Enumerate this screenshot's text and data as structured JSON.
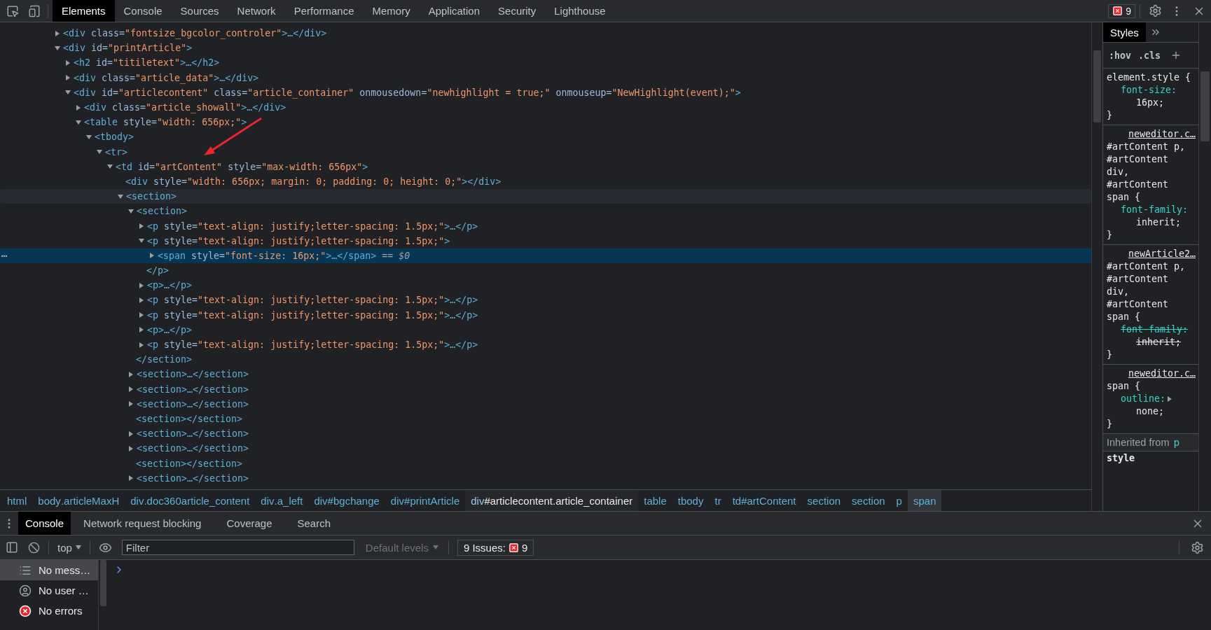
{
  "toolbar": {
    "tabs": [
      {
        "label": "Elements",
        "selected": true
      },
      {
        "label": "Console",
        "selected": false
      },
      {
        "label": "Sources",
        "selected": false
      },
      {
        "label": "Network",
        "selected": false
      },
      {
        "label": "Performance",
        "selected": false
      },
      {
        "label": "Memory",
        "selected": false
      },
      {
        "label": "Application",
        "selected": false
      },
      {
        "label": "Security",
        "selected": false
      },
      {
        "label": "Lighthouse",
        "selected": false
      }
    ],
    "issues_count": "9"
  },
  "dom_tree": [
    {
      "expanded": false,
      "selected": false,
      "hovered": false,
      "tokens": [
        {
          "kind": "tag",
          "text": "<div"
        },
        {
          "kind": "attr",
          "text": " class="
        },
        {
          "kind": "value",
          "text": "\"fontsize_bgcolor_controler\""
        },
        {
          "kind": "tag",
          "text": ">…</div>"
        }
      ]
    },
    {
      "expanded": true,
      "selected": false,
      "hovered": false,
      "tokens": [
        {
          "kind": "tag",
          "text": "<div"
        },
        {
          "kind": "attr",
          "text": " id="
        },
        {
          "kind": "value",
          "text": "\"printArticle\""
        },
        {
          "kind": "tag",
          "text": ">"
        }
      ],
      "children": [
        {
          "expanded": false,
          "selected": false,
          "hovered": false,
          "tokens": [
            {
              "kind": "tag",
              "text": "<h2"
            },
            {
              "kind": "attr",
              "text": " id="
            },
            {
              "kind": "value",
              "text": "\"titiletext\""
            },
            {
              "kind": "tag",
              "text": ">…</h2>"
            }
          ]
        },
        {
          "expanded": false,
          "selected": false,
          "hovered": false,
          "tokens": [
            {
              "kind": "tag",
              "text": "<div"
            },
            {
              "kind": "attr",
              "text": " class="
            },
            {
              "kind": "value",
              "text": "\"article_data\""
            },
            {
              "kind": "tag",
              "text": ">…</div>"
            }
          ]
        },
        {
          "expanded": true,
          "selected": false,
          "hovered": false,
          "tokens": [
            {
              "kind": "tag",
              "text": "<div"
            },
            {
              "kind": "attr",
              "text": " id="
            },
            {
              "kind": "value",
              "text": "\"articlecontent\""
            },
            {
              "kind": "attr",
              "text": " class="
            },
            {
              "kind": "value",
              "text": "\"article_container\""
            },
            {
              "kind": "attr",
              "text": " onmousedown="
            },
            {
              "kind": "value",
              "text": "\"newhighlight = true;\""
            },
            {
              "kind": "attr",
              "text": " onmouseup="
            },
            {
              "kind": "value",
              "text": "\"NewHighlight(event);\""
            },
            {
              "kind": "tag",
              "text": ">"
            }
          ],
          "children": [
            {
              "expanded": false,
              "selected": false,
              "hovered": false,
              "tokens": [
                {
                  "kind": "tag",
                  "text": "<div"
                },
                {
                  "kind": "attr",
                  "text": " class="
                },
                {
                  "kind": "value",
                  "text": "\"article_showall\""
                },
                {
                  "kind": "tag",
                  "text": ">…</div>"
                }
              ]
            },
            {
              "expanded": true,
              "selected": false,
              "hovered": false,
              "tokens": [
                {
                  "kind": "tag",
                  "text": "<table"
                },
                {
                  "kind": "attr",
                  "text": " style="
                },
                {
                  "kind": "value",
                  "text": "\"width: 656px;\""
                },
                {
                  "kind": "tag",
                  "text": ">"
                }
              ],
              "children": [
                {
                  "expanded": true,
                  "selected": false,
                  "hovered": false,
                  "tokens": [
                    {
                      "kind": "tag",
                      "text": "<tbody>"
                    }
                  ],
                  "children": [
                    {
                      "expanded": true,
                      "selected": false,
                      "hovered": false,
                      "tokens": [
                        {
                          "kind": "tag",
                          "text": "<tr>"
                        }
                      ],
                      "children": [
                        {
                          "expanded": true,
                          "selected": false,
                          "hovered": false,
                          "tokens": [
                            {
                              "kind": "tag",
                              "text": "<td"
                            },
                            {
                              "kind": "attr",
                              "text": " id="
                            },
                            {
                              "kind": "value",
                              "text": "\"artContent\""
                            },
                            {
                              "kind": "attr",
                              "text": " style="
                            },
                            {
                              "kind": "value",
                              "text": "\"max-width: 656px\""
                            },
                            {
                              "kind": "tag",
                              "text": ">"
                            }
                          ],
                          "children": [
                            {
                              "selected": false,
                              "hovered": false,
                              "tokens": [
                                {
                                  "kind": "tag",
                                  "text": "<div"
                                },
                                {
                                  "kind": "attr",
                                  "text": " style="
                                },
                                {
                                  "kind": "value",
                                  "text": "\"width: 656px; margin: 0; padding: 0; height: 0;\""
                                },
                                {
                                  "kind": "tag",
                                  "text": "></div>"
                                }
                              ]
                            },
                            {
                              "expanded": true,
                              "selected": false,
                              "hovered": true,
                              "tokens": [
                                {
                                  "kind": "tag",
                                  "text": "<section>"
                                }
                              ],
                              "children": [
                                {
                                  "expanded": true,
                                  "selected": false,
                                  "hovered": false,
                                  "tokens": [
                                    {
                                      "kind": "tag",
                                      "text": "<section>"
                                    }
                                  ],
                                  "close": [
                                    {
                                      "kind": "tag",
                                      "text": "</section>"
                                    }
                                  ],
                                  "children": [
                                    {
                                      "expanded": false,
                                      "selected": false,
                                      "hovered": false,
                                      "tokens": [
                                        {
                                          "kind": "tag",
                                          "text": "<p"
                                        },
                                        {
                                          "kind": "attr",
                                          "text": " style="
                                        },
                                        {
                                          "kind": "value",
                                          "text": "\"text-align: justify;letter-spacing: 1.5px;\""
                                        },
                                        {
                                          "kind": "tag",
                                          "text": ">…</p>"
                                        }
                                      ]
                                    },
                                    {
                                      "expanded": true,
                                      "selected": false,
                                      "hovered": false,
                                      "tokens": [
                                        {
                                          "kind": "tag",
                                          "text": "<p"
                                        },
                                        {
                                          "kind": "attr",
                                          "text": " style="
                                        },
                                        {
                                          "kind": "value",
                                          "text": "\"text-align: justify;letter-spacing: 1.5px;\""
                                        },
                                        {
                                          "kind": "tag",
                                          "text": ">"
                                        }
                                      ],
                                      "close": [
                                        {
                                          "kind": "tag",
                                          "text": "</p>"
                                        }
                                      ],
                                      "children": [
                                        {
                                          "expanded": false,
                                          "selected": true,
                                          "hovered": false,
                                          "gutter": "⋯",
                                          "tokens": [
                                            {
                                              "kind": "tag",
                                              "text": "<span"
                                            },
                                            {
                                              "kind": "attr",
                                              "text": " style="
                                            },
                                            {
                                              "kind": "value",
                                              "text": "\"font-size: 16px;\""
                                            },
                                            {
                                              "kind": "tag",
                                              "text": ">…</span>"
                                            },
                                            {
                                              "kind": "hint",
                                              "text": " == $0"
                                            }
                                          ]
                                        }
                                      ]
                                    },
                                    {
                                      "expanded": false,
                                      "selected": false,
                                      "hovered": false,
                                      "tokens": [
                                        {
                                          "kind": "tag",
                                          "text": "<p>…</p>"
                                        }
                                      ]
                                    },
                                    {
                                      "expanded": false,
                                      "selected": false,
                                      "hovered": false,
                                      "tokens": [
                                        {
                                          "kind": "tag",
                                          "text": "<p"
                                        },
                                        {
                                          "kind": "attr",
                                          "text": " style="
                                        },
                                        {
                                          "kind": "value",
                                          "text": "\"text-align: justify;letter-spacing: 1.5px;\""
                                        },
                                        {
                                          "kind": "tag",
                                          "text": ">…</p>"
                                        }
                                      ]
                                    },
                                    {
                                      "expanded": false,
                                      "selected": false,
                                      "hovered": false,
                                      "tokens": [
                                        {
                                          "kind": "tag",
                                          "text": "<p"
                                        },
                                        {
                                          "kind": "attr",
                                          "text": " style="
                                        },
                                        {
                                          "kind": "value",
                                          "text": "\"text-align: justify;letter-spacing: 1.5px;\""
                                        },
                                        {
                                          "kind": "tag",
                                          "text": ">…</p>"
                                        }
                                      ]
                                    },
                                    {
                                      "expanded": false,
                                      "selected": false,
                                      "hovered": false,
                                      "tokens": [
                                        {
                                          "kind": "tag",
                                          "text": "<p>…</p>"
                                        }
                                      ]
                                    },
                                    {
                                      "expanded": false,
                                      "selected": false,
                                      "hovered": false,
                                      "tokens": [
                                        {
                                          "kind": "tag",
                                          "text": "<p"
                                        },
                                        {
                                          "kind": "attr",
                                          "text": " style="
                                        },
                                        {
                                          "kind": "value",
                                          "text": "\"text-align: justify;letter-spacing: 1.5px;\""
                                        },
                                        {
                                          "kind": "tag",
                                          "text": ">…</p>"
                                        }
                                      ]
                                    }
                                  ]
                                },
                                {
                                  "expanded": false,
                                  "selected": false,
                                  "hovered": false,
                                  "tokens": [
                                    {
                                      "kind": "tag",
                                      "text": "<section>…</section>"
                                    }
                                  ]
                                },
                                {
                                  "expanded": false,
                                  "selected": false,
                                  "hovered": false,
                                  "tokens": [
                                    {
                                      "kind": "tag",
                                      "text": "<section>…</section>"
                                    }
                                  ]
                                },
                                {
                                  "expanded": false,
                                  "selected": false,
                                  "hovered": false,
                                  "tokens": [
                                    {
                                      "kind": "tag",
                                      "text": "<section>…</section>"
                                    }
                                  ]
                                },
                                {
                                  "selected": false,
                                  "hovered": false,
                                  "tokens": [
                                    {
                                      "kind": "tag",
                                      "text": "<section></section>"
                                    }
                                  ]
                                },
                                {
                                  "expanded": false,
                                  "selected": false,
                                  "hovered": false,
                                  "tokens": [
                                    {
                                      "kind": "tag",
                                      "text": "<section>…</section>"
                                    }
                                  ]
                                },
                                {
                                  "expanded": false,
                                  "selected": false,
                                  "hovered": false,
                                  "tokens": [
                                    {
                                      "kind": "tag",
                                      "text": "<section>…</section>"
                                    }
                                  ]
                                },
                                {
                                  "selected": false,
                                  "hovered": false,
                                  "tokens": [
                                    {
                                      "kind": "tag",
                                      "text": "<section></section>"
                                    }
                                  ]
                                },
                                {
                                  "expanded": false,
                                  "selected": false,
                                  "hovered": false,
                                  "tokens": [
                                    {
                                      "kind": "tag",
                                      "text": "<section>…</section>"
                                    }
                                  ]
                                }
                              ]
                            }
                          ]
                        }
                      ]
                    }
                  ]
                }
              ]
            }
          ]
        }
      ]
    }
  ],
  "breadcrumbs": [
    {
      "tag": "html",
      "selected": false,
      "hovered": false
    },
    {
      "tag": "body",
      "suffix": ".articleMaxH",
      "selected": false,
      "hovered": false
    },
    {
      "tag": "div",
      "suffix": ".doc360article_content",
      "selected": false,
      "hovered": false
    },
    {
      "tag": "div",
      "suffix": ".a_left",
      "selected": false,
      "hovered": false
    },
    {
      "tag": "div",
      "suffix": "#bgchange",
      "selected": false,
      "hovered": false
    },
    {
      "tag": "div",
      "suffix": "#printArticle",
      "selected": false,
      "hovered": false
    },
    {
      "tag": "div",
      "suffix": "#articlecontent.article_container",
      "selected": false,
      "hovered": true
    },
    {
      "tag": "table",
      "selected": false,
      "hovered": false
    },
    {
      "tag": "tbody",
      "selected": false,
      "hovered": false
    },
    {
      "tag": "tr",
      "selected": false,
      "hovered": false
    },
    {
      "tag": "td",
      "suffix": "#artContent",
      "selected": false,
      "hovered": false
    },
    {
      "tag": "section",
      "selected": false,
      "hovered": false
    },
    {
      "tag": "section",
      "selected": false,
      "hovered": false
    },
    {
      "tag": "p",
      "selected": false,
      "hovered": false
    },
    {
      "tag": "span",
      "selected": true,
      "hovered": false
    }
  ],
  "styles_pane": {
    "tabs": [
      {
        "label": "Styles",
        "selected": true
      }
    ],
    "hov": ":hov",
    "cls": ".cls",
    "rules": [
      {
        "selector": "element.style {",
        "close": "}",
        "properties": [
          {
            "name": "font-size:",
            "value": "16px;",
            "overridden": false,
            "expandable": false
          }
        ]
      },
      {
        "source": "neweditor.c…",
        "selector": "#artContent p, #artContent div, #artContent span {",
        "close": "}",
        "properties": [
          {
            "name": "font-family:",
            "value": "inherit;",
            "overridden": false,
            "expandable": false
          }
        ]
      },
      {
        "source": "newArticle2…",
        "selector": "#artContent p, #artContent div, #artContent span {",
        "close": "}",
        "properties": [
          {
            "name": "font-family:",
            "value": "inherit;",
            "overridden": true,
            "expandable": false
          }
        ]
      },
      {
        "source": "neweditor.c…",
        "selector": "span {",
        "close": "}",
        "properties": [
          {
            "name": "outline:",
            "value": "none;",
            "overridden": false,
            "expandable": true
          }
        ]
      }
    ],
    "inherited": {
      "label": "Inherited from",
      "element": "p"
    },
    "next_selector": "style"
  },
  "drawer": {
    "tabs": [
      {
        "label": "Console",
        "selected": true
      },
      {
        "label": "Network request blocking",
        "selected": false
      },
      {
        "label": "Coverage",
        "selected": false
      },
      {
        "label": "Search",
        "selected": false
      }
    ],
    "context": "top",
    "filter_placeholder": "Filter",
    "levels": {
      "label": "Default levels",
      "disabled": true
    },
    "issues_label": "9 Issues:",
    "issues_count": "9",
    "sidebar": [
      {
        "kind": "messages",
        "label": "No mess…",
        "selected": true
      },
      {
        "kind": "user",
        "label": "No user …",
        "selected": false
      },
      {
        "kind": "errors",
        "label": "No errors",
        "selected": false
      }
    ]
  }
}
